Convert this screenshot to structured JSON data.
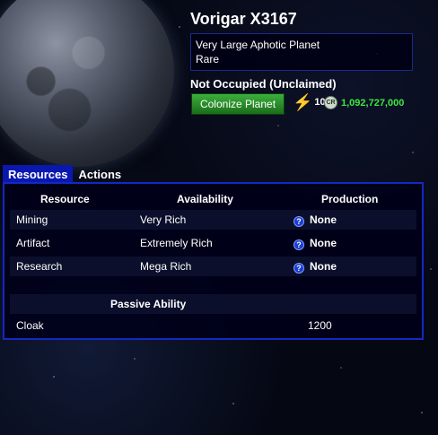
{
  "planet": {
    "name": "Vorigar X3167",
    "type": "Very Large Aphotic Planet",
    "rarity": "Rare",
    "status": "Not Occupied (Unclaimed)"
  },
  "actions": {
    "colonize_label": "Colonize Planet",
    "energy_cost": "10",
    "credit_icon_text": "CR",
    "credit_cost": "1,092,727,000"
  },
  "tabs": [
    {
      "label": "Resources",
      "active": true
    },
    {
      "label": "Actions",
      "active": false
    }
  ],
  "resources": {
    "headers": {
      "resource": "Resource",
      "availability": "Availability",
      "production": "Production"
    },
    "rows": [
      {
        "resource": "Mining",
        "availability": "Very Rich",
        "production": "None"
      },
      {
        "resource": "Artifact",
        "availability": "Extremely Rich",
        "production": "None"
      },
      {
        "resource": "Research",
        "availability": "Mega Rich",
        "production": "None"
      }
    ]
  },
  "passive": {
    "header": "Passive Ability",
    "name": "Cloak",
    "value": "1200"
  },
  "colors": {
    "tab_active": "#0a18b0",
    "panel_border": "#1428c4",
    "button_green": "#2a8f2a",
    "credits_green": "#3ee83e",
    "energy_yellow": "#ffcf2e"
  }
}
